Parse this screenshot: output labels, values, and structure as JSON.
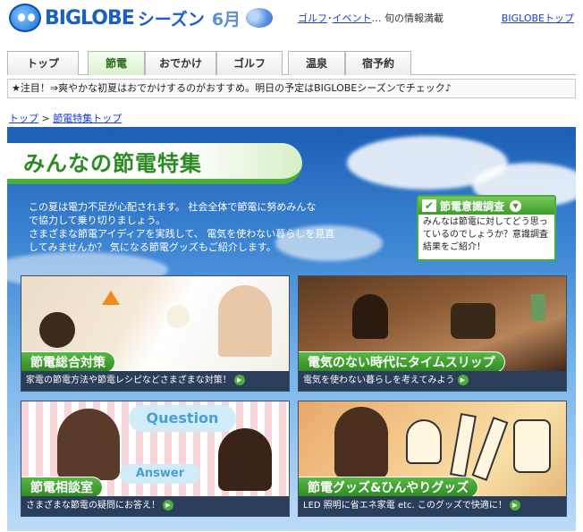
{
  "header": {
    "brand": "BIGLOBE",
    "season_label": "シーズン",
    "month_label": "6月",
    "links": [
      {
        "label": "ゴルフ"
      },
      {
        "label": "イベント"
      }
    ],
    "links_separator": "･",
    "tagline": "… 旬の情報満載",
    "top_link": "BIGLOBEトップ"
  },
  "nav": {
    "tabs": [
      {
        "label": "トップ",
        "active": false
      },
      {
        "label": "節電",
        "active": true
      },
      {
        "label": "おでかけ",
        "active": false
      },
      {
        "label": "ゴルフ",
        "active": false
      },
      {
        "label": "温泉",
        "active": false
      },
      {
        "label": "宿予約",
        "active": false
      }
    ]
  },
  "notice": {
    "text": "★注目！⇒爽やかな初夏はおでかけするのがおすすめ。明日の予定はBIGLOBEシーズンでチェック♪"
  },
  "breadcrumb": {
    "items": [
      "トップ",
      "節電特集トップ"
    ],
    "separator": ">"
  },
  "feature": {
    "title": "みんなの節電特集",
    "intro_lines": [
      "この夏は電力不足が心配されます。 社会全体で節電に努めみんな",
      "で協力して乗り切りましょう。",
      "さまざまな節電アイディアを実践して、 電気を使わない暮らしを見直",
      "してみませんか？ 気になる節電グッズもご紹介します。"
    ],
    "survey": {
      "title": "節電意識調査",
      "text": "みんなは節電に対してどう思っているのでしょうか？意識調査結果をご紹介！"
    },
    "cards": [
      {
        "label": "節電総合対策",
        "caption": "家電の節電方法や節電レシピなどさまざまな対策！"
      },
      {
        "label": "電気のない時代にタイムスリップ",
        "caption": "電気を使わない暮らしを考えてみよう"
      },
      {
        "label": "節電相談室",
        "caption": "さまざまな節電の疑問にお答え！"
      },
      {
        "label": "節電グッズ&ひんやりグッズ",
        "caption": "LED 照明に省エネ家電 etc. このグッズで快適に！"
      }
    ],
    "card3_decor": {
      "question": "Question",
      "answer": "Answer"
    }
  },
  "icons": {
    "mascot": "biglobe-mascot-icon",
    "hydrangea": "hydrangea-icon",
    "check": "checkmark-icon",
    "play": "play-arrow-icon"
  },
  "colors": {
    "brand_blue": "#1b5fc4",
    "accent_green": "#4aae3a",
    "link_blue": "#1a3ad6"
  }
}
